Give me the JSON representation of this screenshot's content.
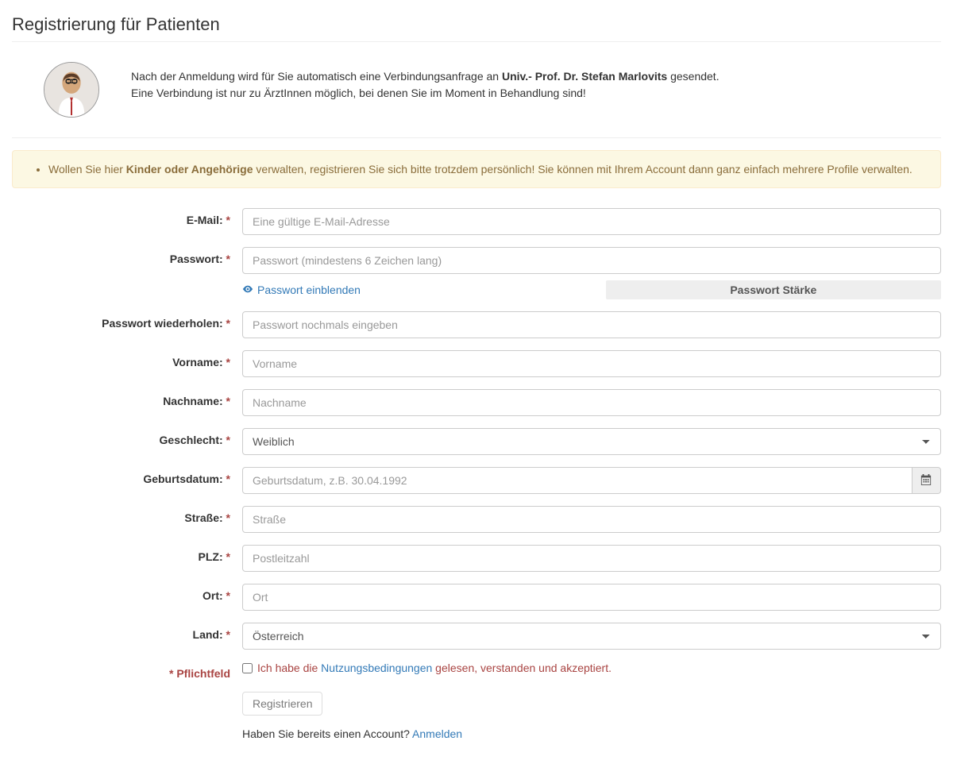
{
  "page": {
    "title": "Registrierung für Patienten"
  },
  "intro": {
    "line1_pre": "Nach der Anmeldung wird für Sie automatisch eine Verbindungsanfrage an ",
    "line1_bold": "Univ.- Prof. Dr. Stefan Marlovits",
    "line1_post": " gesendet.",
    "line2": "Eine Verbindung ist nur zu ÄrztInnen möglich, bei denen Sie im Moment in Behandlung sind!"
  },
  "alert": {
    "pre": "Wollen Sie hier ",
    "bold": "Kinder oder Angehörige",
    "post": " verwalten, registrieren Sie sich bitte trotzdem persönlich! Sie können mit Ihrem Account dann ganz einfach mehrere Profile verwalten."
  },
  "labels": {
    "email": "E-Mail:",
    "password": "Passwort:",
    "password_repeat": "Passwort wiederholen:",
    "firstname": "Vorname:",
    "lastname": "Nachname:",
    "gender": "Geschlecht:",
    "birthdate": "Geburtsdatum:",
    "street": "Straße:",
    "zip": "PLZ:",
    "city": "Ort:",
    "country": "Land:",
    "required_note": "* Pflichtfeld",
    "asterisk": " *"
  },
  "placeholders": {
    "email": "Eine gültige E-Mail-Adresse",
    "password": "Passwort (mindestens 6 Zeichen lang)",
    "password_repeat": "Passwort nochmals eingeben",
    "firstname": "Vorname",
    "lastname": "Nachname",
    "birthdate": "Geburtsdatum, z.B. 30.04.1992",
    "street": "Straße",
    "zip": "Postleitzahl",
    "city": "Ort"
  },
  "options": {
    "gender_selected": "Weiblich",
    "country_selected": "Österreich"
  },
  "password_ui": {
    "show": "Passwort einblenden",
    "strength": "Passwort Stärke"
  },
  "terms": {
    "pre": "Ich habe die ",
    "link": "Nutzungsbedingungen",
    "post": " gelesen, verstanden und akzeptiert."
  },
  "actions": {
    "register": "Registrieren",
    "login_pre": "Haben Sie bereits einen Account? ",
    "login_link": "Anmelden"
  }
}
